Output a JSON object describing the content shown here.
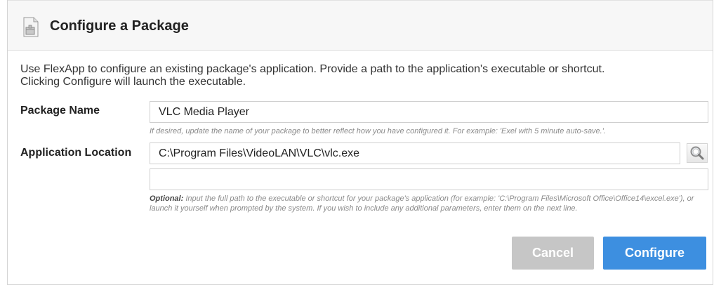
{
  "dialog": {
    "title": "Configure a Package",
    "icon": "package-doc-icon",
    "intro_line1": "Use FlexApp to configure an existing package's application. Provide a path to the application's executable or shortcut.",
    "intro_line2": "Clicking Configure will launch the executable."
  },
  "package_name": {
    "label": "Package Name",
    "value": "VLC Media Player",
    "hint": "If desired, update the name of your package to better reflect how you have configured it. For example: 'Exel with 5 minute auto-save.'."
  },
  "application_location": {
    "label": "Application Location",
    "value": "C:\\Program Files\\VideoLAN\\VLC\\vlc.exe",
    "parameters_value": "",
    "browse_icon": "magnifier-icon",
    "hint_prefix": "Optional:",
    "hint": " Input the full path to the executable or shortcut for your package's application (for example: 'C:\\Program Files\\Microsoft Office\\Office14\\excel.exe'), or launch it yourself when prompted by the system. If you wish to include any additional parameters, enter them on the next line."
  },
  "buttons": {
    "cancel": "Cancel",
    "configure": "Configure"
  },
  "colors": {
    "configure_button": "#3d8fe0",
    "cancel_button_disabled": "#c6c6c6"
  }
}
